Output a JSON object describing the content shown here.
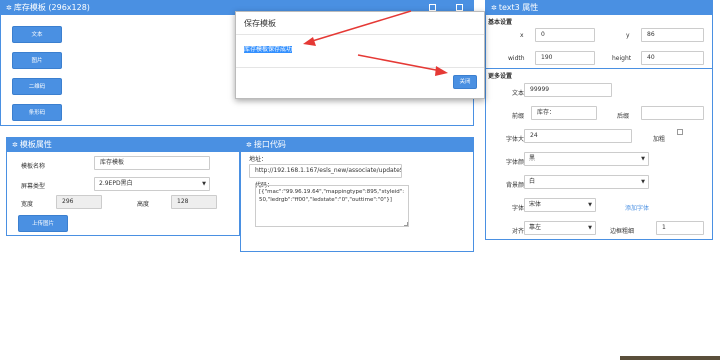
{
  "template_panel": {
    "title": "库存模板 (296x128)",
    "buttons": [
      "文本",
      "图片",
      "二维码",
      "条形码"
    ],
    "toolbar_icons": [
      "save-icon",
      "export-icon"
    ]
  },
  "modal": {
    "title": "保存模板",
    "message": "库存模板保存成功",
    "close_label": "关闭"
  },
  "props_panel": {
    "title": "text3 属性",
    "basic_section": "基本设置",
    "x_label": "x",
    "x_value": "0",
    "y_label": "y",
    "y_value": "86",
    "width_label": "width",
    "width_value": "190",
    "height_label": "height",
    "height_value": "40",
    "more_section": "更多设置",
    "text_label": "文本",
    "text_value": "99999",
    "prefix_label": "前缀",
    "prefix_value": "库存：",
    "suffix_label": "后缀",
    "suffix_value": "",
    "font_size_label": "字体大小",
    "font_size_value": "24",
    "bold_label": "加粗",
    "font_color_label": "字体颜色",
    "font_color_value": "黑",
    "bg_color_label": "背景颜色",
    "bg_color_value": "白",
    "font_label": "字体",
    "font_value": "宋体",
    "add_font_link": "添加字体",
    "align_label": "对齐",
    "align_value": "靠左",
    "border_label": "边框粗细",
    "border_value": "1"
  },
  "template_props": {
    "title": "模板属性",
    "name_label": "模板名称",
    "name_value": "库存模板",
    "screen_label": "屏幕类型",
    "screen_value": "2.9EPD黑白",
    "width_label": "宽度",
    "width_value": "296",
    "height_label": "高度",
    "height_value": "128",
    "upload_label": "上传图片"
  },
  "api_panel": {
    "title": "接口代码",
    "url_label": "地址：",
    "url_value": "http://192.168.1.167/esls_new/associate/updateScre",
    "code_label": "代码：",
    "code_value": "[{\"mac\":\"99.96.19.64\",\"mappingtype\":895,\"styleid\":50,\"ledrgb\":\"ff00\",\"ledstate\":\"0\",\"outtime\":\"0\"}]"
  },
  "colors": {
    "accent": "#4a90e2",
    "arrow": "#e53935",
    "highlight": "#3390ff"
  }
}
